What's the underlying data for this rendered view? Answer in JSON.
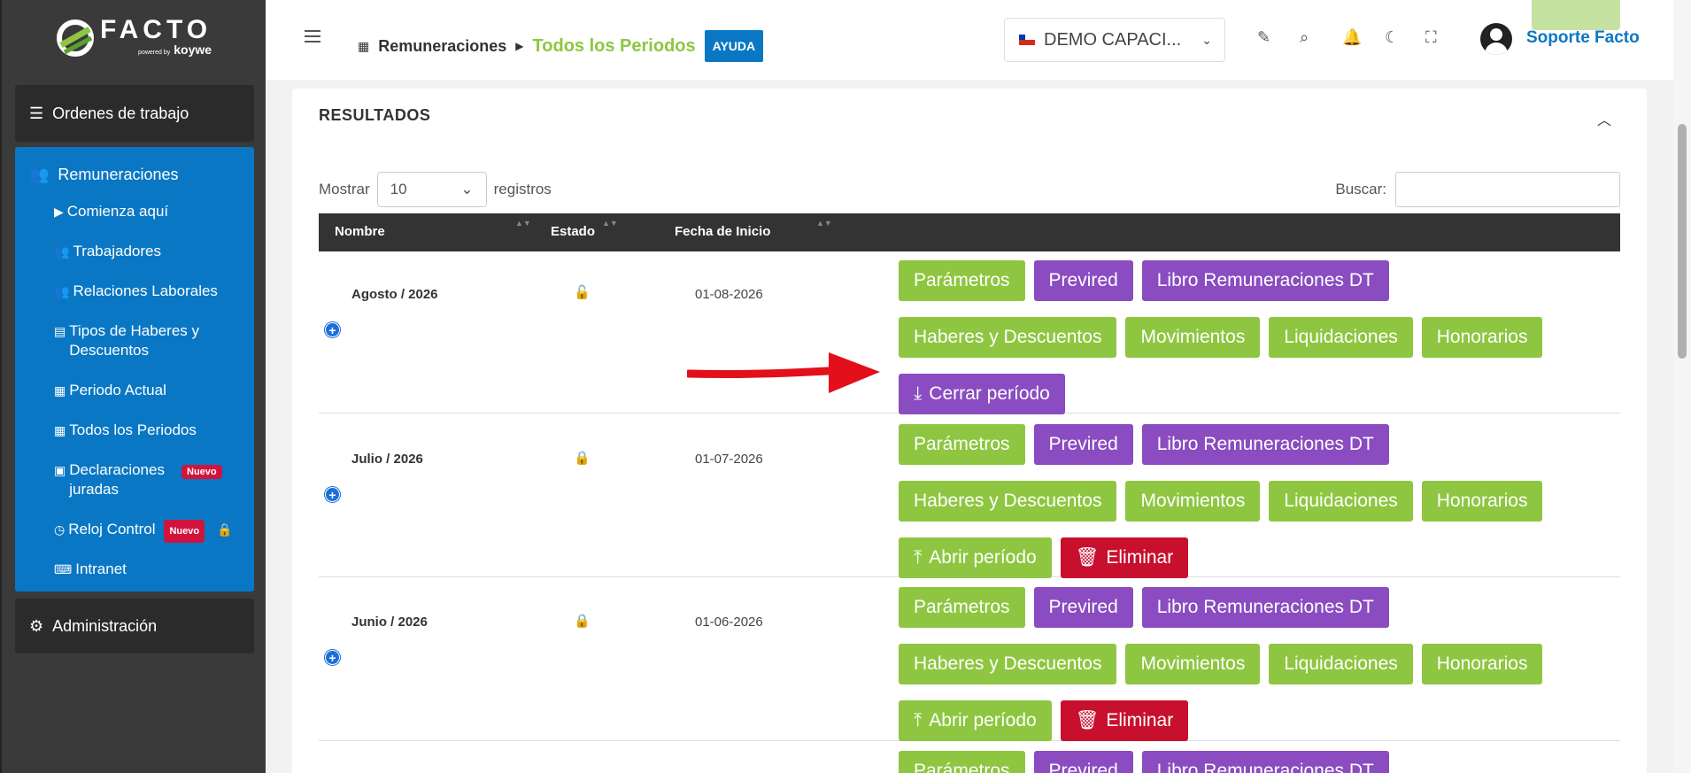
{
  "brand": {
    "name": "FACTO",
    "powered": "powered by",
    "company": "koywe"
  },
  "sidebar": {
    "ordenes": "Ordenes de trabajo",
    "remuneraciones": "Remuneraciones",
    "items": [
      {
        "label": "Comienza aquí",
        "icon": "play-icon"
      },
      {
        "label": "Trabajadores",
        "icon": "users-icon"
      },
      {
        "label": "Relaciones Laborales",
        "icon": "user-group-icon"
      },
      {
        "label": "Tipos de Haberes y Descuentos",
        "icon": "file-icon"
      },
      {
        "label": "Periodo Actual",
        "icon": "calendar-icon"
      },
      {
        "label": "Todos los Periodos",
        "icon": "calendar-icon"
      },
      {
        "label": "Declaraciones juradas",
        "icon": "archive-icon",
        "badge": "Nuevo"
      },
      {
        "label": "Reloj Control",
        "icon": "clock-icon",
        "badge": "Nuevo"
      },
      {
        "label": "Intranet",
        "icon": "intranet-icon"
      }
    ],
    "admin": "Administración"
  },
  "header": {
    "crumb_parent": "Remuneraciones",
    "crumb_current": "Todos los Periodos",
    "help": "AYUDA",
    "company": "DEMO CAPACI...",
    "user": "Soporte Facto",
    "top_search_btn": "Buscar"
  },
  "results": {
    "title": "RESULTADOS",
    "show_label": "Mostrar",
    "show_value": "10",
    "records_label": "registros",
    "search_label": "Buscar:",
    "columns": [
      "Nombre",
      "Estado",
      "Fecha de Inicio"
    ],
    "rows": [
      {
        "name": "Agosto / 2026",
        "date": "01-08-2026",
        "state": "unlocked"
      },
      {
        "name": "Julio / 2026",
        "date": "01-07-2026",
        "state": "locked"
      },
      {
        "name": "Junio / 2026",
        "date": "01-06-2026",
        "state": "locked"
      }
    ],
    "buttons": {
      "parametros": "Parámetros",
      "previred": "Previred",
      "libro": "Libro Remuneraciones DT",
      "haberes": "Haberes y Descuentos",
      "movimientos": "Movimientos",
      "liquidaciones": "Liquidaciones",
      "honorarios": "Honorarios",
      "cerrar": "Cerrar período",
      "abrir": "Abrir período",
      "eliminar": "Eliminar"
    }
  },
  "colors": {
    "green": "#8ec641",
    "purple": "#8a4cc0",
    "red": "#c8102e",
    "blue": "#0a77c4",
    "arrow": "#e3101c"
  }
}
